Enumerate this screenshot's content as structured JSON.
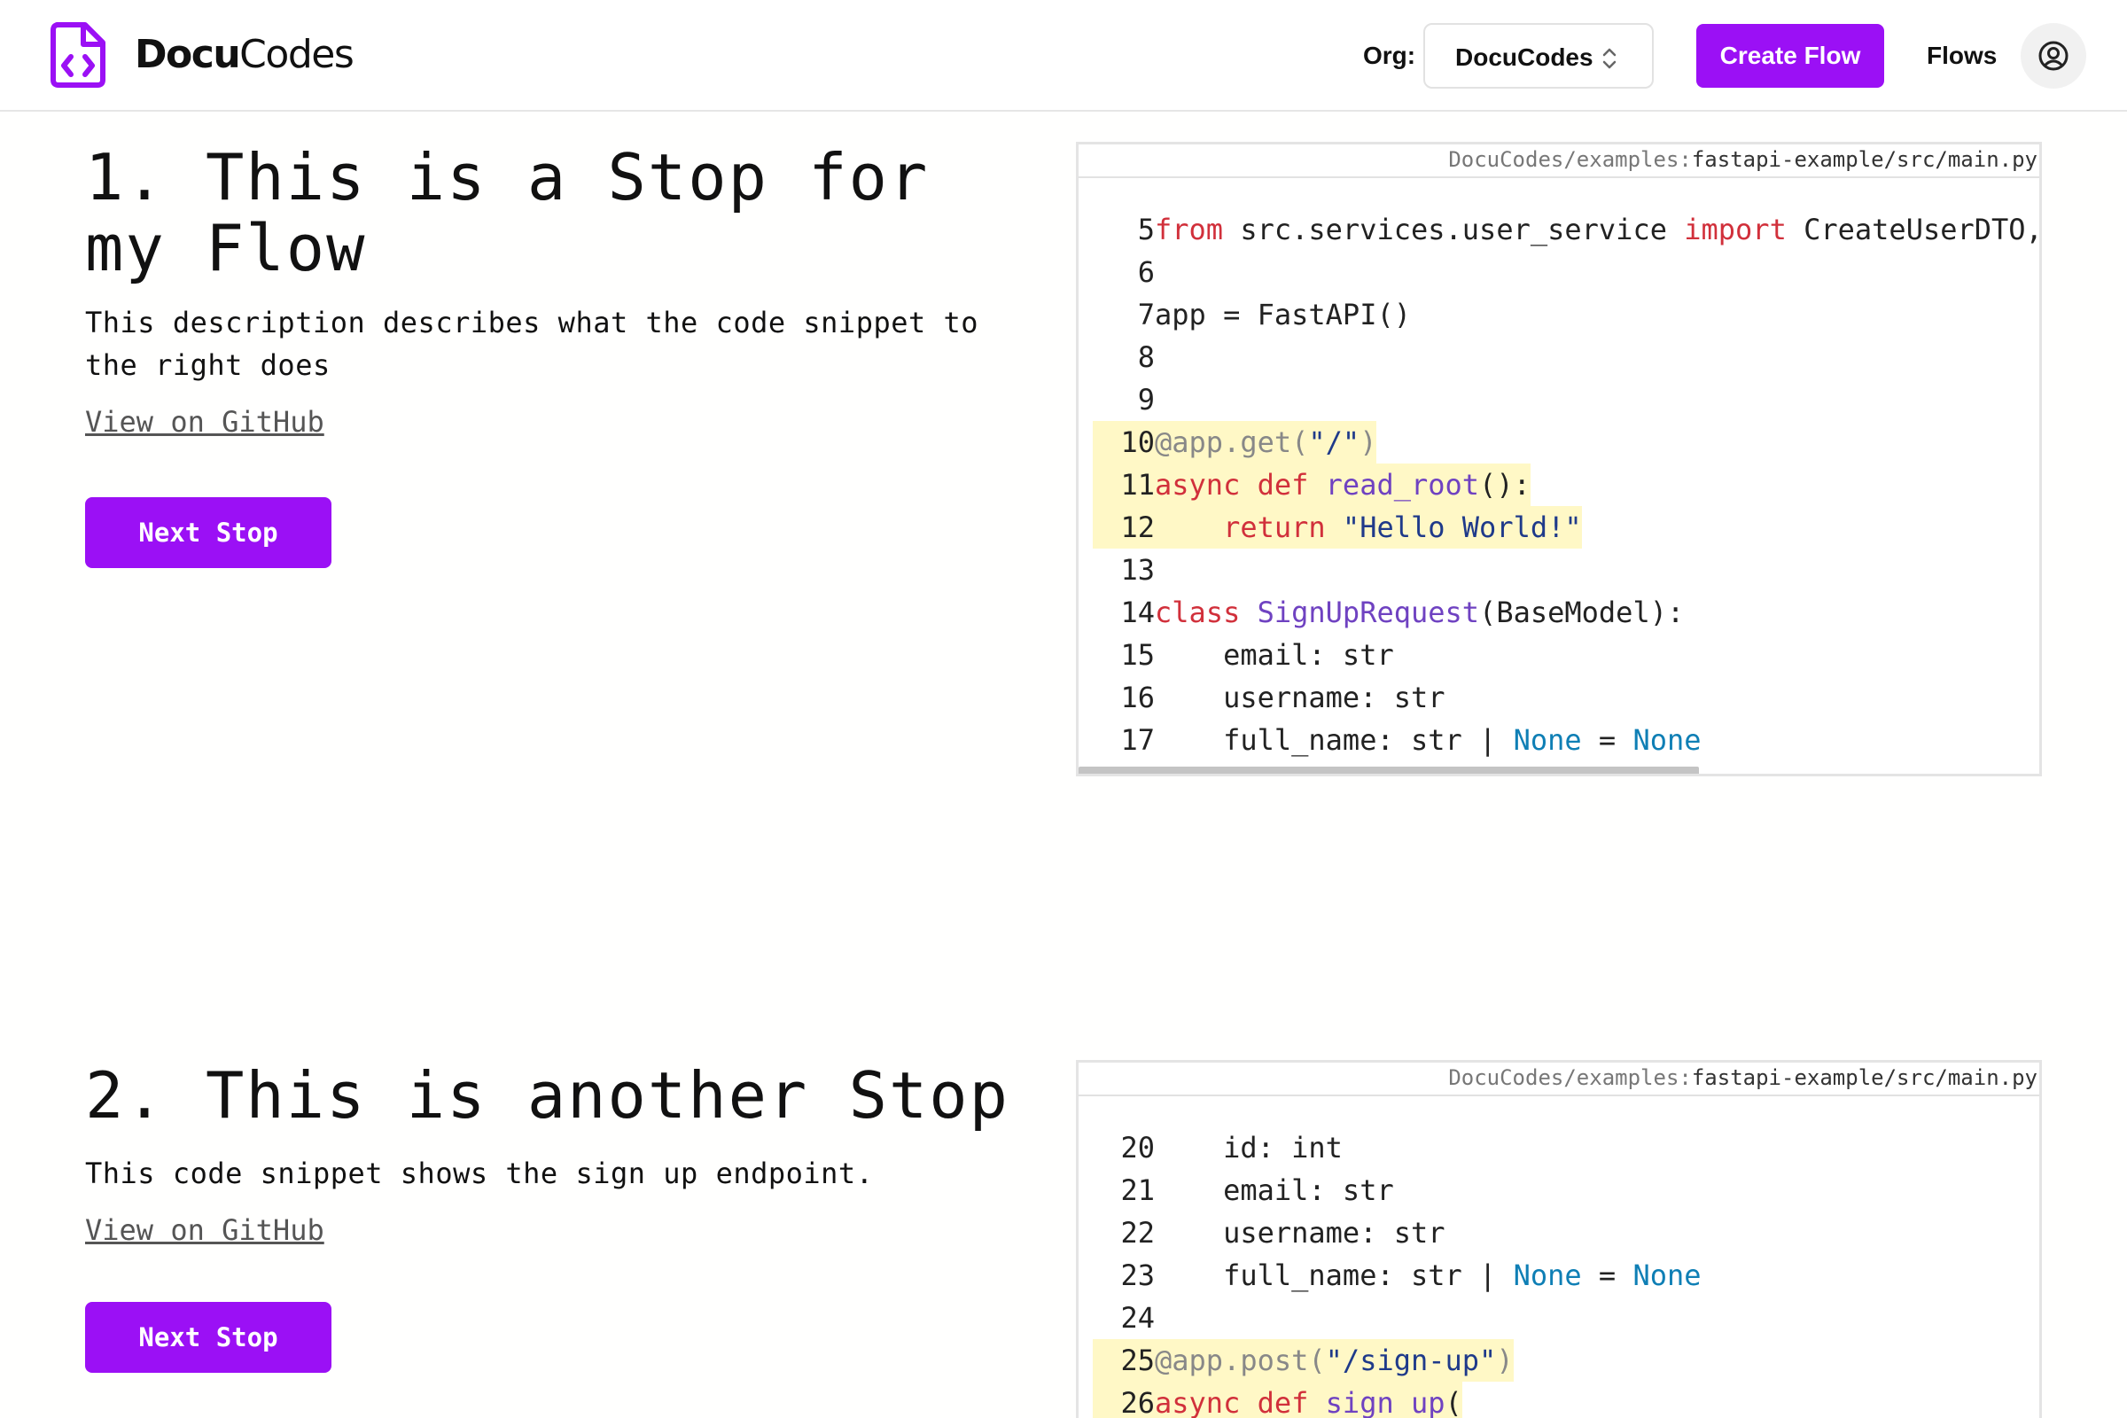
{
  "header": {
    "brand_bold": "Docu",
    "brand_light": "Codes",
    "org_label": "Org:",
    "org_value": "DocuCodes",
    "create_flow_label": "Create Flow",
    "flows_label": "Flows",
    "icons": {
      "logo": "file-code-icon",
      "chevron": "chevron-up-down-icon",
      "avatar": "user-circle-icon"
    },
    "colors": {
      "accent": "#9b10f5"
    }
  },
  "stops": [
    {
      "title": "1. This is a Stop for my Flow",
      "description": "This description describes what the code snippet to the right does",
      "github_label": "View on GitHub",
      "next_label": "Next Stop",
      "code": {
        "path_repo": "DocuCodes/examples:",
        "path_file": "fastapi-example/src/main.py",
        "lines": [
          {
            "n": "5",
            "text": "from src.services.user_service import CreateUserDTO,"
          },
          {
            "n": "6",
            "text": ""
          },
          {
            "n": "7",
            "text": "app = FastAPI()"
          },
          {
            "n": "8",
            "text": ""
          },
          {
            "n": "9",
            "text": ""
          },
          {
            "n": "10",
            "text": "@app.get(\"/\")"
          },
          {
            "n": "11",
            "text": "async def read_root():"
          },
          {
            "n": "12",
            "text": "    return \"Hello World!\""
          },
          {
            "n": "13",
            "text": ""
          },
          {
            "n": "14",
            "text": "class SignUpRequest(BaseModel):"
          },
          {
            "n": "15",
            "text": "    email: str"
          },
          {
            "n": "16",
            "text": "    username: str"
          },
          {
            "n": "17",
            "text": "    full_name: str | None = None"
          }
        ]
      }
    },
    {
      "title": "2. This is another Stop",
      "description": "This code snippet shows the sign up endpoint.",
      "github_label": "View on GitHub",
      "next_label": "Next Stop",
      "code": {
        "path_repo": "DocuCodes/examples:",
        "path_file": "fastapi-example/src/main.py",
        "lines": [
          {
            "n": "20",
            "text": "    id: int"
          },
          {
            "n": "21",
            "text": "    email: str"
          },
          {
            "n": "22",
            "text": "    username: str"
          },
          {
            "n": "23",
            "text": "    full_name: str | None = None"
          },
          {
            "n": "24",
            "text": ""
          },
          {
            "n": "25",
            "text": "@app.post(\"/sign-up\")"
          },
          {
            "n": "26",
            "text": "async def sign_up("
          }
        ]
      }
    }
  ]
}
